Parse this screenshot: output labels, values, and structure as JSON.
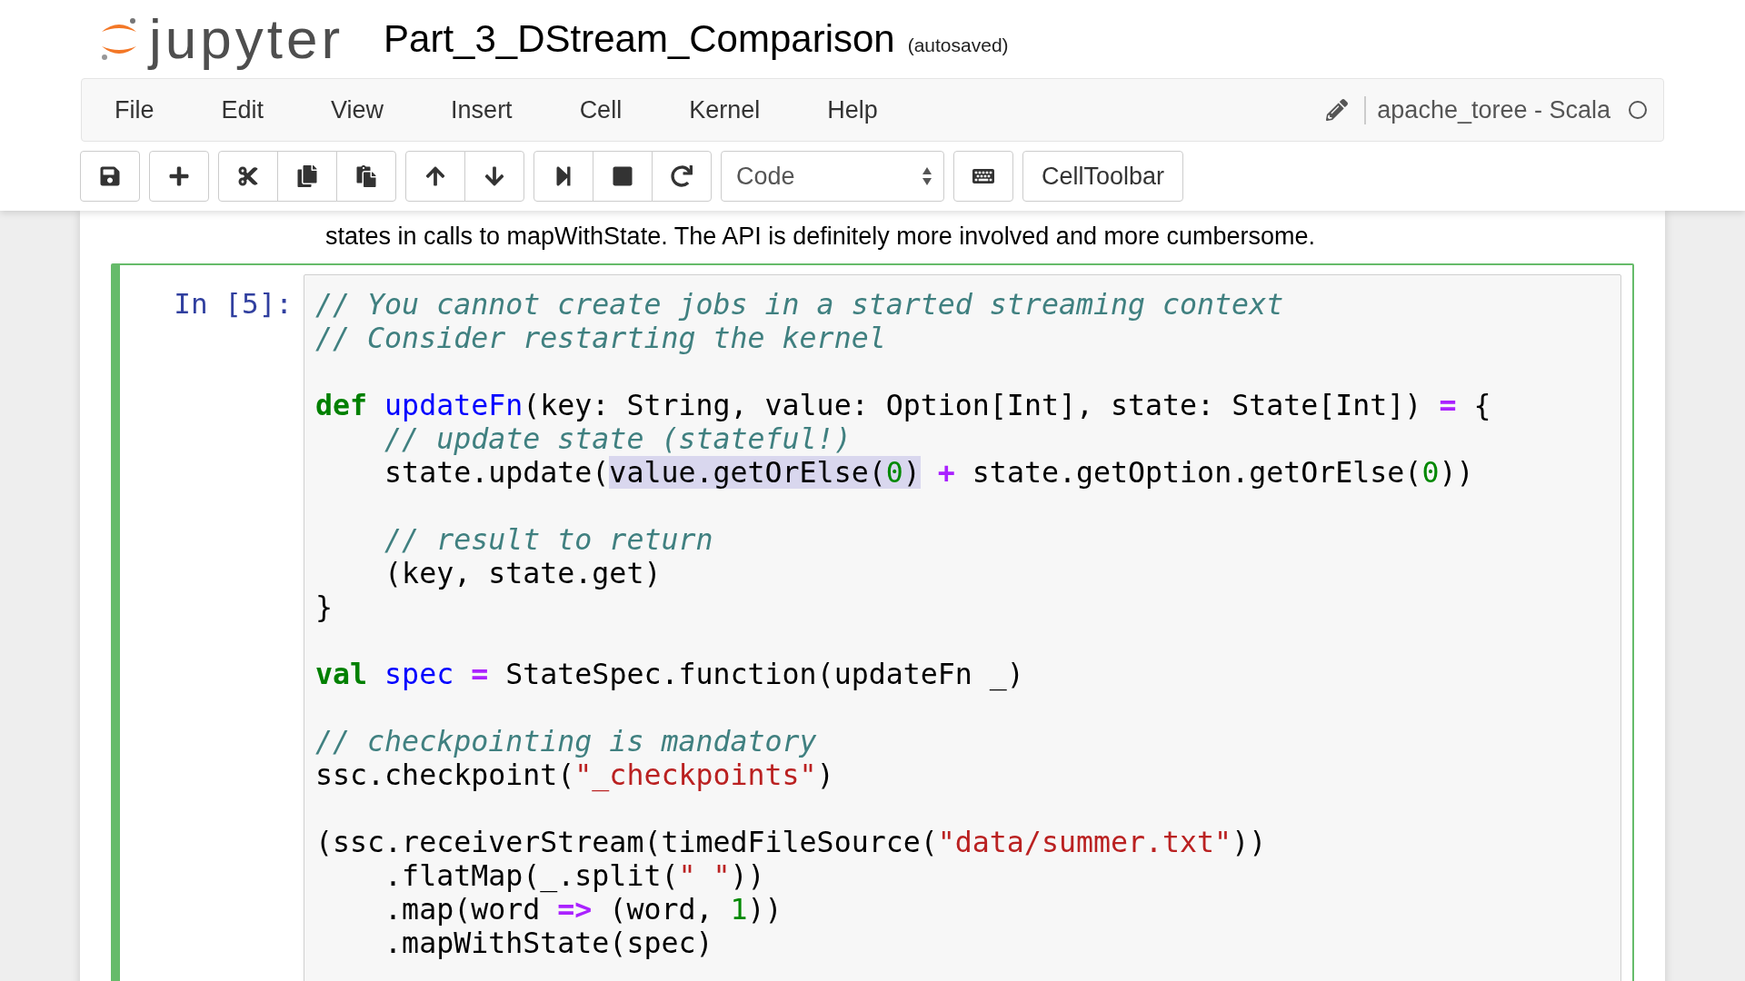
{
  "header": {
    "logo_text": "jupyter",
    "notebook_name": "Part_3_DStream_Comparison",
    "save_status": "(autosaved)"
  },
  "menu": {
    "items": [
      "File",
      "Edit",
      "View",
      "Insert",
      "Cell",
      "Kernel",
      "Help"
    ],
    "kernel_name": "apache_toree - Scala",
    "kernel_busy": false
  },
  "toolbar": {
    "cell_type": "Code",
    "cell_toolbar_label": "CellToolbar"
  },
  "markdown_text": "states in calls to mapWithState. The API is definitely more involved and more cumbersome.",
  "cell": {
    "prompt": "In [5]:",
    "selected": true,
    "lines": [
      {
        "kind": "code",
        "segments": [
          {
            "text": "// You cannot create jobs in a started streaming context",
            "kind": "comment"
          }
        ]
      },
      {
        "kind": "code",
        "segments": [
          {
            "text": "// Consider restarting the kernel",
            "kind": "comment"
          }
        ]
      },
      {
        "kind": "blank"
      },
      {
        "kind": "code",
        "segments": [
          {
            "text": "def ",
            "kind": "keyword"
          },
          {
            "text": "updateFn",
            "kind": "name"
          },
          {
            "text": "(key: String, value: Option[Int], state: State[Int]) ",
            "kind": "plain"
          },
          {
            "text": "=",
            "kind": "operator"
          },
          {
            "text": " {",
            "kind": "plain"
          }
        ]
      },
      {
        "kind": "code",
        "segments": [
          {
            "text": "    // update state (stateful!)",
            "kind": "comment"
          }
        ]
      },
      {
        "kind": "code",
        "segments": [
          {
            "text": "    state.update(",
            "kind": "plain"
          },
          {
            "kind": "selection",
            "segments": [
              {
                "text": "value.getOrElse(",
                "kind": "plain"
              },
              {
                "text": "0",
                "kind": "number"
              },
              {
                "text": ")",
                "kind": "plain"
              }
            ]
          },
          {
            "text": " +",
            "kind": "operator"
          },
          {
            "text": " state.getOption.getOrElse(",
            "kind": "plain"
          },
          {
            "text": "0",
            "kind": "number"
          },
          {
            "text": "))",
            "kind": "plain"
          }
        ]
      },
      {
        "kind": "blank"
      },
      {
        "kind": "code",
        "segments": [
          {
            "text": "    // result to return",
            "kind": "comment"
          }
        ]
      },
      {
        "kind": "code",
        "segments": [
          {
            "text": "    (key, state.get)",
            "kind": "plain"
          }
        ]
      },
      {
        "kind": "code",
        "segments": [
          {
            "text": "}",
            "kind": "plain"
          }
        ]
      },
      {
        "kind": "blank"
      },
      {
        "kind": "code",
        "segments": [
          {
            "text": "val ",
            "kind": "keyword"
          },
          {
            "text": "spec ",
            "kind": "name"
          },
          {
            "text": "=",
            "kind": "operator"
          },
          {
            "text": " StateSpec.function(updateFn _)",
            "kind": "plain"
          }
        ]
      },
      {
        "kind": "blank"
      },
      {
        "kind": "code",
        "segments": [
          {
            "text": "// checkpointing is mandatory",
            "kind": "comment"
          }
        ]
      },
      {
        "kind": "code",
        "segments": [
          {
            "text": "ssc.checkpoint(",
            "kind": "plain"
          },
          {
            "text": "\"_checkpoints\"",
            "kind": "string"
          },
          {
            "text": ")",
            "kind": "plain"
          }
        ]
      },
      {
        "kind": "blank"
      },
      {
        "kind": "code",
        "segments": [
          {
            "text": "(ssc.receiverStream(timedFileSource(",
            "kind": "plain"
          },
          {
            "text": "\"data/summer.txt\"",
            "kind": "string"
          },
          {
            "text": "))",
            "kind": "plain"
          }
        ]
      },
      {
        "kind": "code",
        "segments": [
          {
            "text": "    .flatMap(_.split(",
            "kind": "plain"
          },
          {
            "text": "\" \"",
            "kind": "string"
          },
          {
            "text": "))",
            "kind": "plain"
          }
        ]
      },
      {
        "kind": "code",
        "segments": [
          {
            "text": "    .map(word ",
            "kind": "plain"
          },
          {
            "text": "=>",
            "kind": "operator"
          },
          {
            "text": " (word, ",
            "kind": "plain"
          },
          {
            "text": "1",
            "kind": "number"
          },
          {
            "text": "))",
            "kind": "plain"
          }
        ]
      },
      {
        "kind": "code",
        "segments": [
          {
            "text": "    .mapWithState(spec)",
            "kind": "plain"
          }
        ]
      }
    ]
  }
}
